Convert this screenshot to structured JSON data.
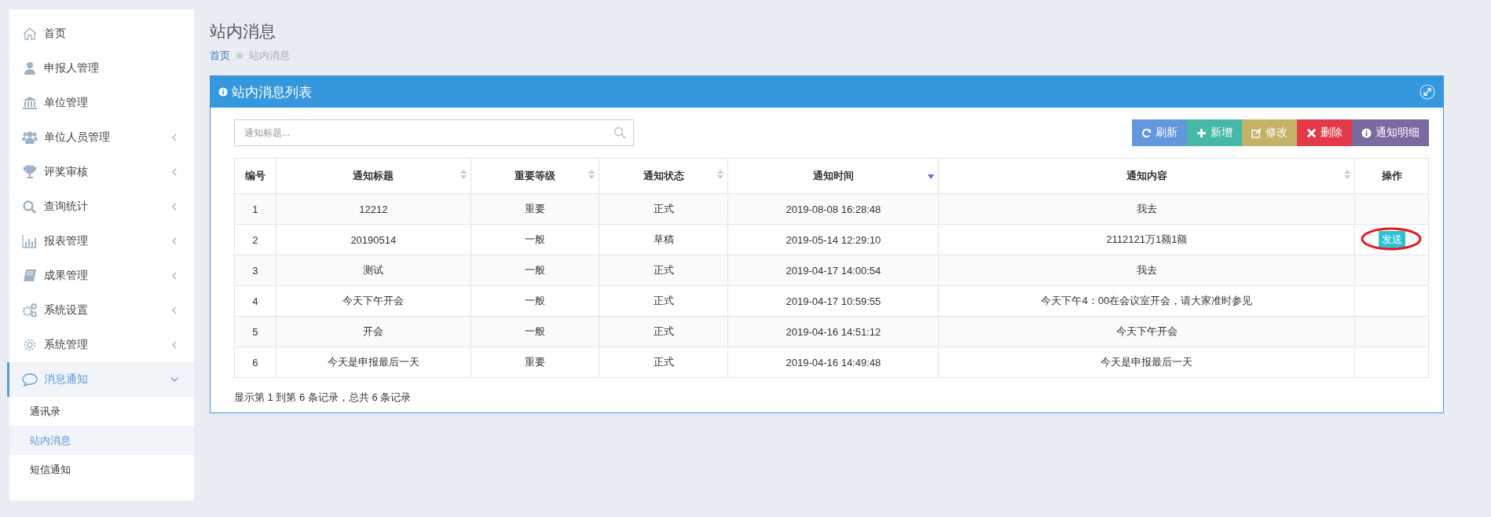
{
  "sidebar": {
    "items": [
      {
        "kind": "home",
        "label": "首页",
        "selected": false
      },
      {
        "kind": "user",
        "label": "申报人管理",
        "selected": false
      },
      {
        "kind": "bank",
        "label": "单位管理",
        "selected": false
      },
      {
        "kind": "users",
        "label": "单位人员管理",
        "expanded": false,
        "selected": false
      },
      {
        "kind": "trophy",
        "label": "评奖审核",
        "expanded": false,
        "selected": false
      },
      {
        "kind": "search",
        "label": "查询统计",
        "expanded": false,
        "selected": false
      },
      {
        "kind": "chart",
        "label": "报表管理",
        "expanded": false,
        "selected": false
      },
      {
        "kind": "book",
        "label": "成果管理",
        "expanded": false,
        "selected": false
      },
      {
        "kind": "gears",
        "label": "系统设置",
        "expanded": false,
        "selected": false
      },
      {
        "kind": "gear",
        "label": "系统管理",
        "expanded": false,
        "selected": false
      },
      {
        "kind": "chat",
        "label": "消息通知",
        "expanded": true,
        "selected": true,
        "children": [
          {
            "label": "通讯录",
            "selected": false
          },
          {
            "label": "站内消息",
            "selected": true
          },
          {
            "label": "短信通知",
            "selected": false
          }
        ]
      }
    ]
  },
  "page_title": "站内消息",
  "breadcrumb": [
    {
      "label": "首页",
      "kind": "link"
    },
    {
      "label": "站内消息",
      "kind": "current"
    }
  ],
  "panel": {
    "title": "站内消息列表",
    "search": {
      "placeholder": "通知标题..."
    },
    "buttons": [
      {
        "label": "刷新",
        "kind": "refresh"
      },
      {
        "label": "新增",
        "kind": "add"
      },
      {
        "label": "修改",
        "kind": "edit"
      },
      {
        "label": "删除",
        "kind": "delete"
      },
      {
        "label": "通知明细",
        "kind": "info"
      }
    ],
    "table": {
      "columns": [
        {
          "label": "编号"
        },
        {
          "label": "通知标题",
          "sortable": true,
          "sorted": false
        },
        {
          "label": "重要等级",
          "sortable": true,
          "sorted": false
        },
        {
          "label": "通知状态",
          "sortable": true,
          "sorted": false
        },
        {
          "label": "通知时间",
          "sortable": true,
          "sorted": true
        },
        {
          "label": "通知内容",
          "sortable": true,
          "sorted": false
        },
        {
          "label": "操作"
        }
      ],
      "rows": [
        {
          "cells": [
            "1",
            "12212",
            "重要",
            "正式",
            "2019-08-08 16:28:48",
            "我去"
          ]
        },
        {
          "cells": [
            "2",
            "20190514",
            "一般",
            "草稿",
            "2019-05-14 12:29:10",
            "2112121万1额1额"
          ],
          "action": "发送",
          "circled": true
        },
        {
          "cells": [
            "3",
            "测试",
            "一般",
            "正式",
            "2019-04-17 14:00:54",
            "我去"
          ]
        },
        {
          "cells": [
            "4",
            "今天下午开会",
            "一般",
            "正式",
            "2019-04-17 10:59:55",
            "今天下午4：00在会议室开会，请大家准时参见"
          ]
        },
        {
          "cells": [
            "5",
            "开会",
            "一般",
            "正式",
            "2019-04-16 14:51:12",
            "今天下午开会"
          ]
        },
        {
          "cells": [
            "6",
            "今天是申报最后一天",
            "重要",
            "正式",
            "2019-04-16 14:49:48",
            "今天是申报最后一天"
          ]
        }
      ]
    },
    "footer": "显示第 1 到第 6 条记录，总共 6 条记录"
  }
}
